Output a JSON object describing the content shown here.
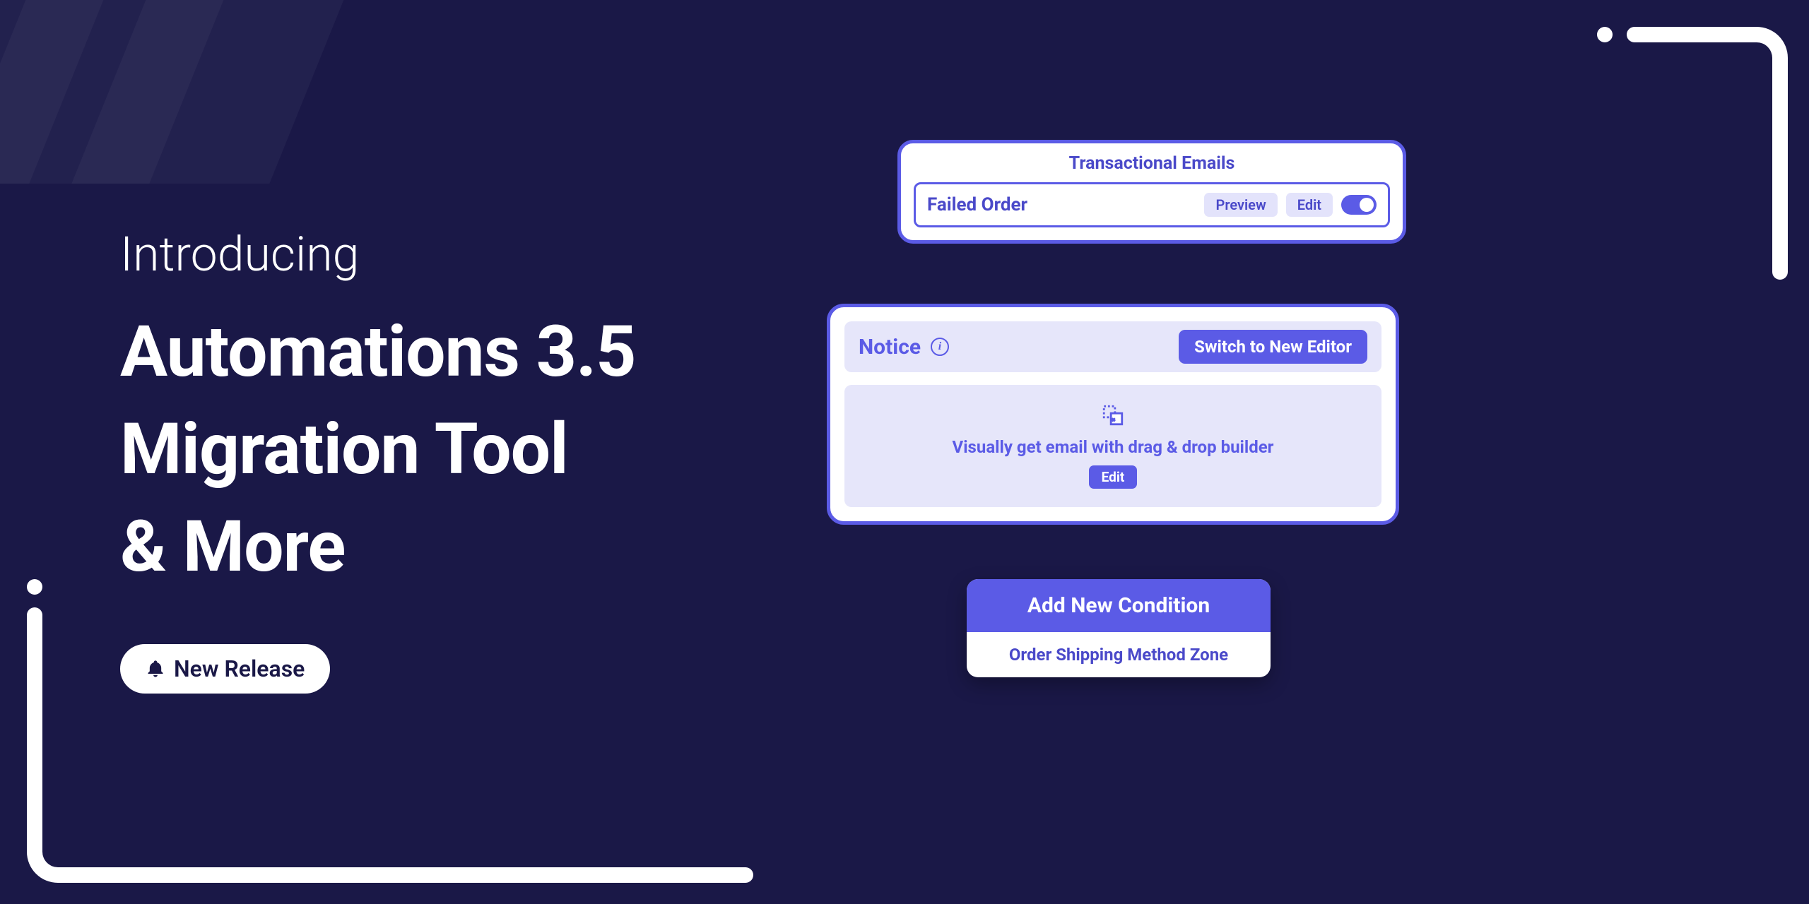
{
  "hero": {
    "intro": "Introducing",
    "headline_l1": "Automations 3.5",
    "headline_l2": "Migration Tool",
    "headline_l3": "& More",
    "badge_label": "New Release"
  },
  "emails_card": {
    "title": "Transactional Emails",
    "row_name": "Failed Order",
    "preview_label": "Preview",
    "edit_label": "Edit"
  },
  "notice_card": {
    "title": "Notice",
    "switch_label": "Switch to New Editor",
    "builder_text": "Visually get email with drag & drop builder",
    "edit_label": "Edit"
  },
  "condition_card": {
    "title": "Add New Condition",
    "option": "Order Shipping Method Zone"
  }
}
